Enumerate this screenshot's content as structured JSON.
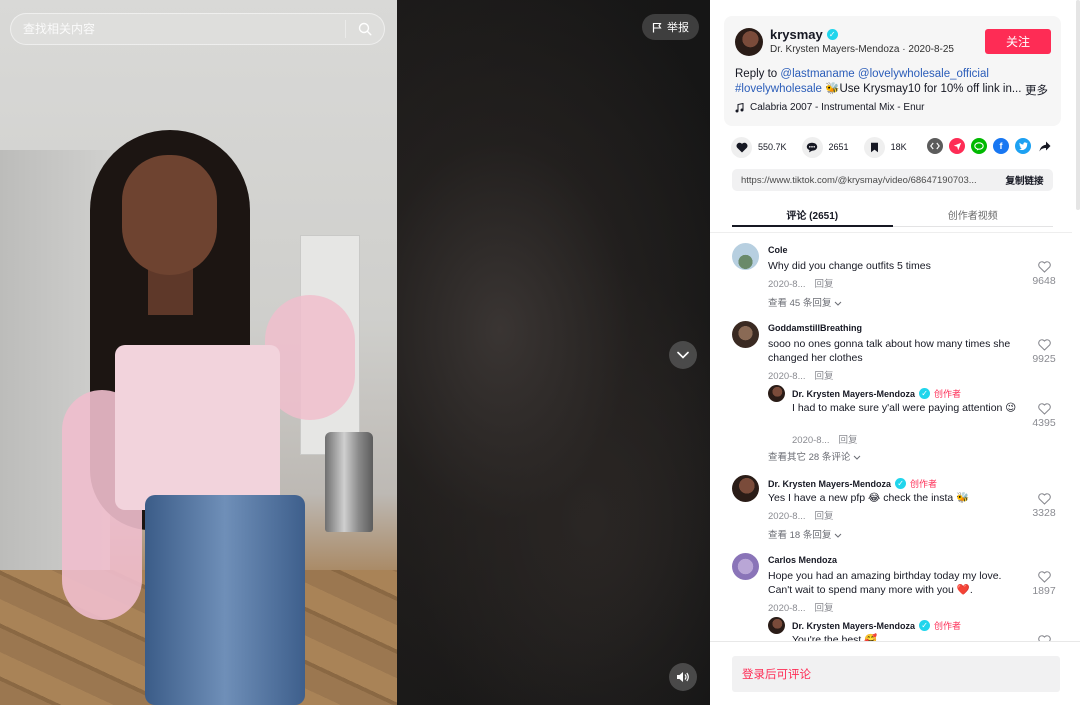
{
  "search": {
    "placeholder": "查找相关内容"
  },
  "video": {
    "report_label": "举报"
  },
  "author": {
    "handle": "krysmay",
    "display_name": "Dr. Krysten Mayers-Mendoza",
    "date": "2020-8-25",
    "follow_label": "关注",
    "verified": true
  },
  "description": {
    "prefix": "Reply to ",
    "mentions": [
      "@lastmaname",
      "@lovelywholesale_official"
    ],
    "hashtag": "#lovelywholesale",
    "emoji": "🐝",
    "text": "Use Krysmay10 for 10% off link in...",
    "more_label": "更多",
    "music": "Calabria 2007 - Instrumental Mix - Enur"
  },
  "stats": {
    "likes": "550.7K",
    "comments": "2651",
    "saves": "18K"
  },
  "share_icons": [
    "embed-icon",
    "send-icon",
    "line-icon",
    "facebook-icon",
    "twitter-icon",
    "share-arrow-icon"
  ],
  "colors": {
    "accent": "#fe2c55",
    "link": "#2b5db9",
    "verified": "#20d5ec",
    "meta": "#8a8b91"
  },
  "link": {
    "url": "https://www.tiktok.com/@krysmay/video/68647190703...",
    "copy_label": "复制链接"
  },
  "tabs": [
    {
      "label": "评论 (2651)",
      "active": true
    },
    {
      "label": "创作者视频",
      "active": false
    }
  ],
  "comments": [
    {
      "user": "Cole",
      "text": "Why did you change outfits 5 times",
      "date": "2020-8...",
      "reply_label": "回复",
      "likes": "9648",
      "more": "查看 45 条回复"
    },
    {
      "user": "GoddamstillBreathing",
      "text": "sooo no ones gonna talk about how many times she changed her clothes",
      "date": "2020-8...",
      "reply_label": "回复",
      "likes": "9925",
      "reply": {
        "user": "Dr. Krysten Mayers-Mendoza",
        "tag": "创作者",
        "text": "I had to make sure y'all were paying attention 😉",
        "date": "2020-8...",
        "reply_label": "回复",
        "likes": "4395"
      },
      "more": "查看其它 28 条评论"
    },
    {
      "user": "Dr. Krysten Mayers-Mendoza",
      "tag": "创作者",
      "text": "Yes I have a new pfp 😂 check the insta 🐝",
      "date": "2020-8...",
      "reply_label": "回复",
      "likes": "3328",
      "more": "查看 18 条回复"
    },
    {
      "user": "Carlos Mendoza",
      "text": "Hope you had an amazing birthday today my love. Can't wait to spend many more with you ❤️.",
      "date": "2020-8...",
      "reply_label": "回复",
      "likes": "1897",
      "reply": {
        "user": "Dr. Krysten Mayers-Mendoza",
        "tag": "创作者",
        "text": "You're the best 🥰"
      }
    }
  ],
  "login_prompt": "登录后可评论"
}
